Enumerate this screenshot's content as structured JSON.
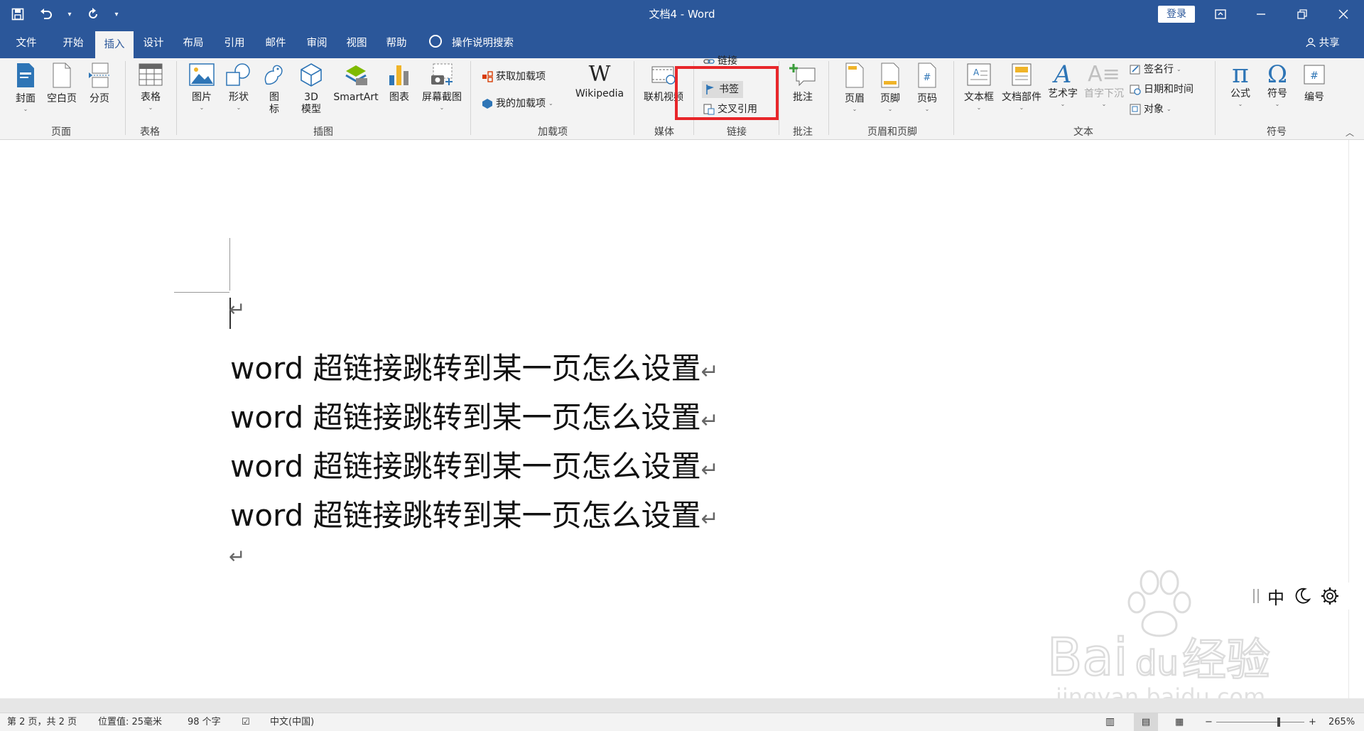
{
  "window": {
    "title": "文档4 - Word",
    "login_label": "登录",
    "share_label": "共享"
  },
  "tabs": [
    "文件",
    "开始",
    "插入",
    "设计",
    "布局",
    "引用",
    "邮件",
    "审阅",
    "视图",
    "帮助"
  ],
  "active_tab": "插入",
  "tellme": "操作说明搜索",
  "ribbon": {
    "groups": {
      "pages": "页面",
      "tables": "表格",
      "illustrations": "插图",
      "addins": "加载项",
      "media": "媒体",
      "links": "链接",
      "comments": "批注",
      "header_footer": "页眉和页脚",
      "text": "文本",
      "symbols": "符号"
    },
    "buttons": {
      "cover": "封面",
      "blank_page": "空白页",
      "page_break": "分页",
      "table": "表格",
      "picture": "图片",
      "shapes": "形状",
      "icons_a": "图",
      "icons_b": "标",
      "model3d_a": "3D",
      "model3d_b": "模型",
      "smartart": "SmartArt",
      "chart": "图表",
      "screenshot": "屏幕截图",
      "get_addins": "获取加载项",
      "my_addins": "我的加载项",
      "wikipedia": "Wikipedia",
      "online_video": "联机视频",
      "link": "链接",
      "bookmark": "书签",
      "cross_ref": "交叉引用",
      "comment": "批注",
      "header": "页眉",
      "footer": "页脚",
      "page_number": "页码",
      "textbox": "文本框",
      "quick_parts": "文档部件",
      "wordart": "艺术字",
      "drop_cap": "首字下沉",
      "signature_line": "签名行",
      "date_time": "日期和时间",
      "object": "对象",
      "equation": "公式",
      "symbol": "符号",
      "number": "编号"
    }
  },
  "document": {
    "lines": [
      "word 超链接跳转到某一页怎么设置",
      "word 超链接跳转到某一页怎么设置",
      "word 超链接跳转到某一页怎么设置",
      "word 超链接跳转到某一页怎么设置"
    ],
    "paragraph_mark": "↵"
  },
  "ime": {
    "mode": "中"
  },
  "status": {
    "page": "第 2 页，共 2 页",
    "position": "位置值: 25毫米",
    "words": "98 个字",
    "language": "中文(中国)",
    "zoom": "265%"
  },
  "watermark": {
    "brand": "Baidu经验",
    "url": "jingyan.baidu.com"
  },
  "colors": {
    "title_bar": "#2b579a",
    "ribbon": "#f3f3f3",
    "highlight_box": "#e8262a"
  }
}
